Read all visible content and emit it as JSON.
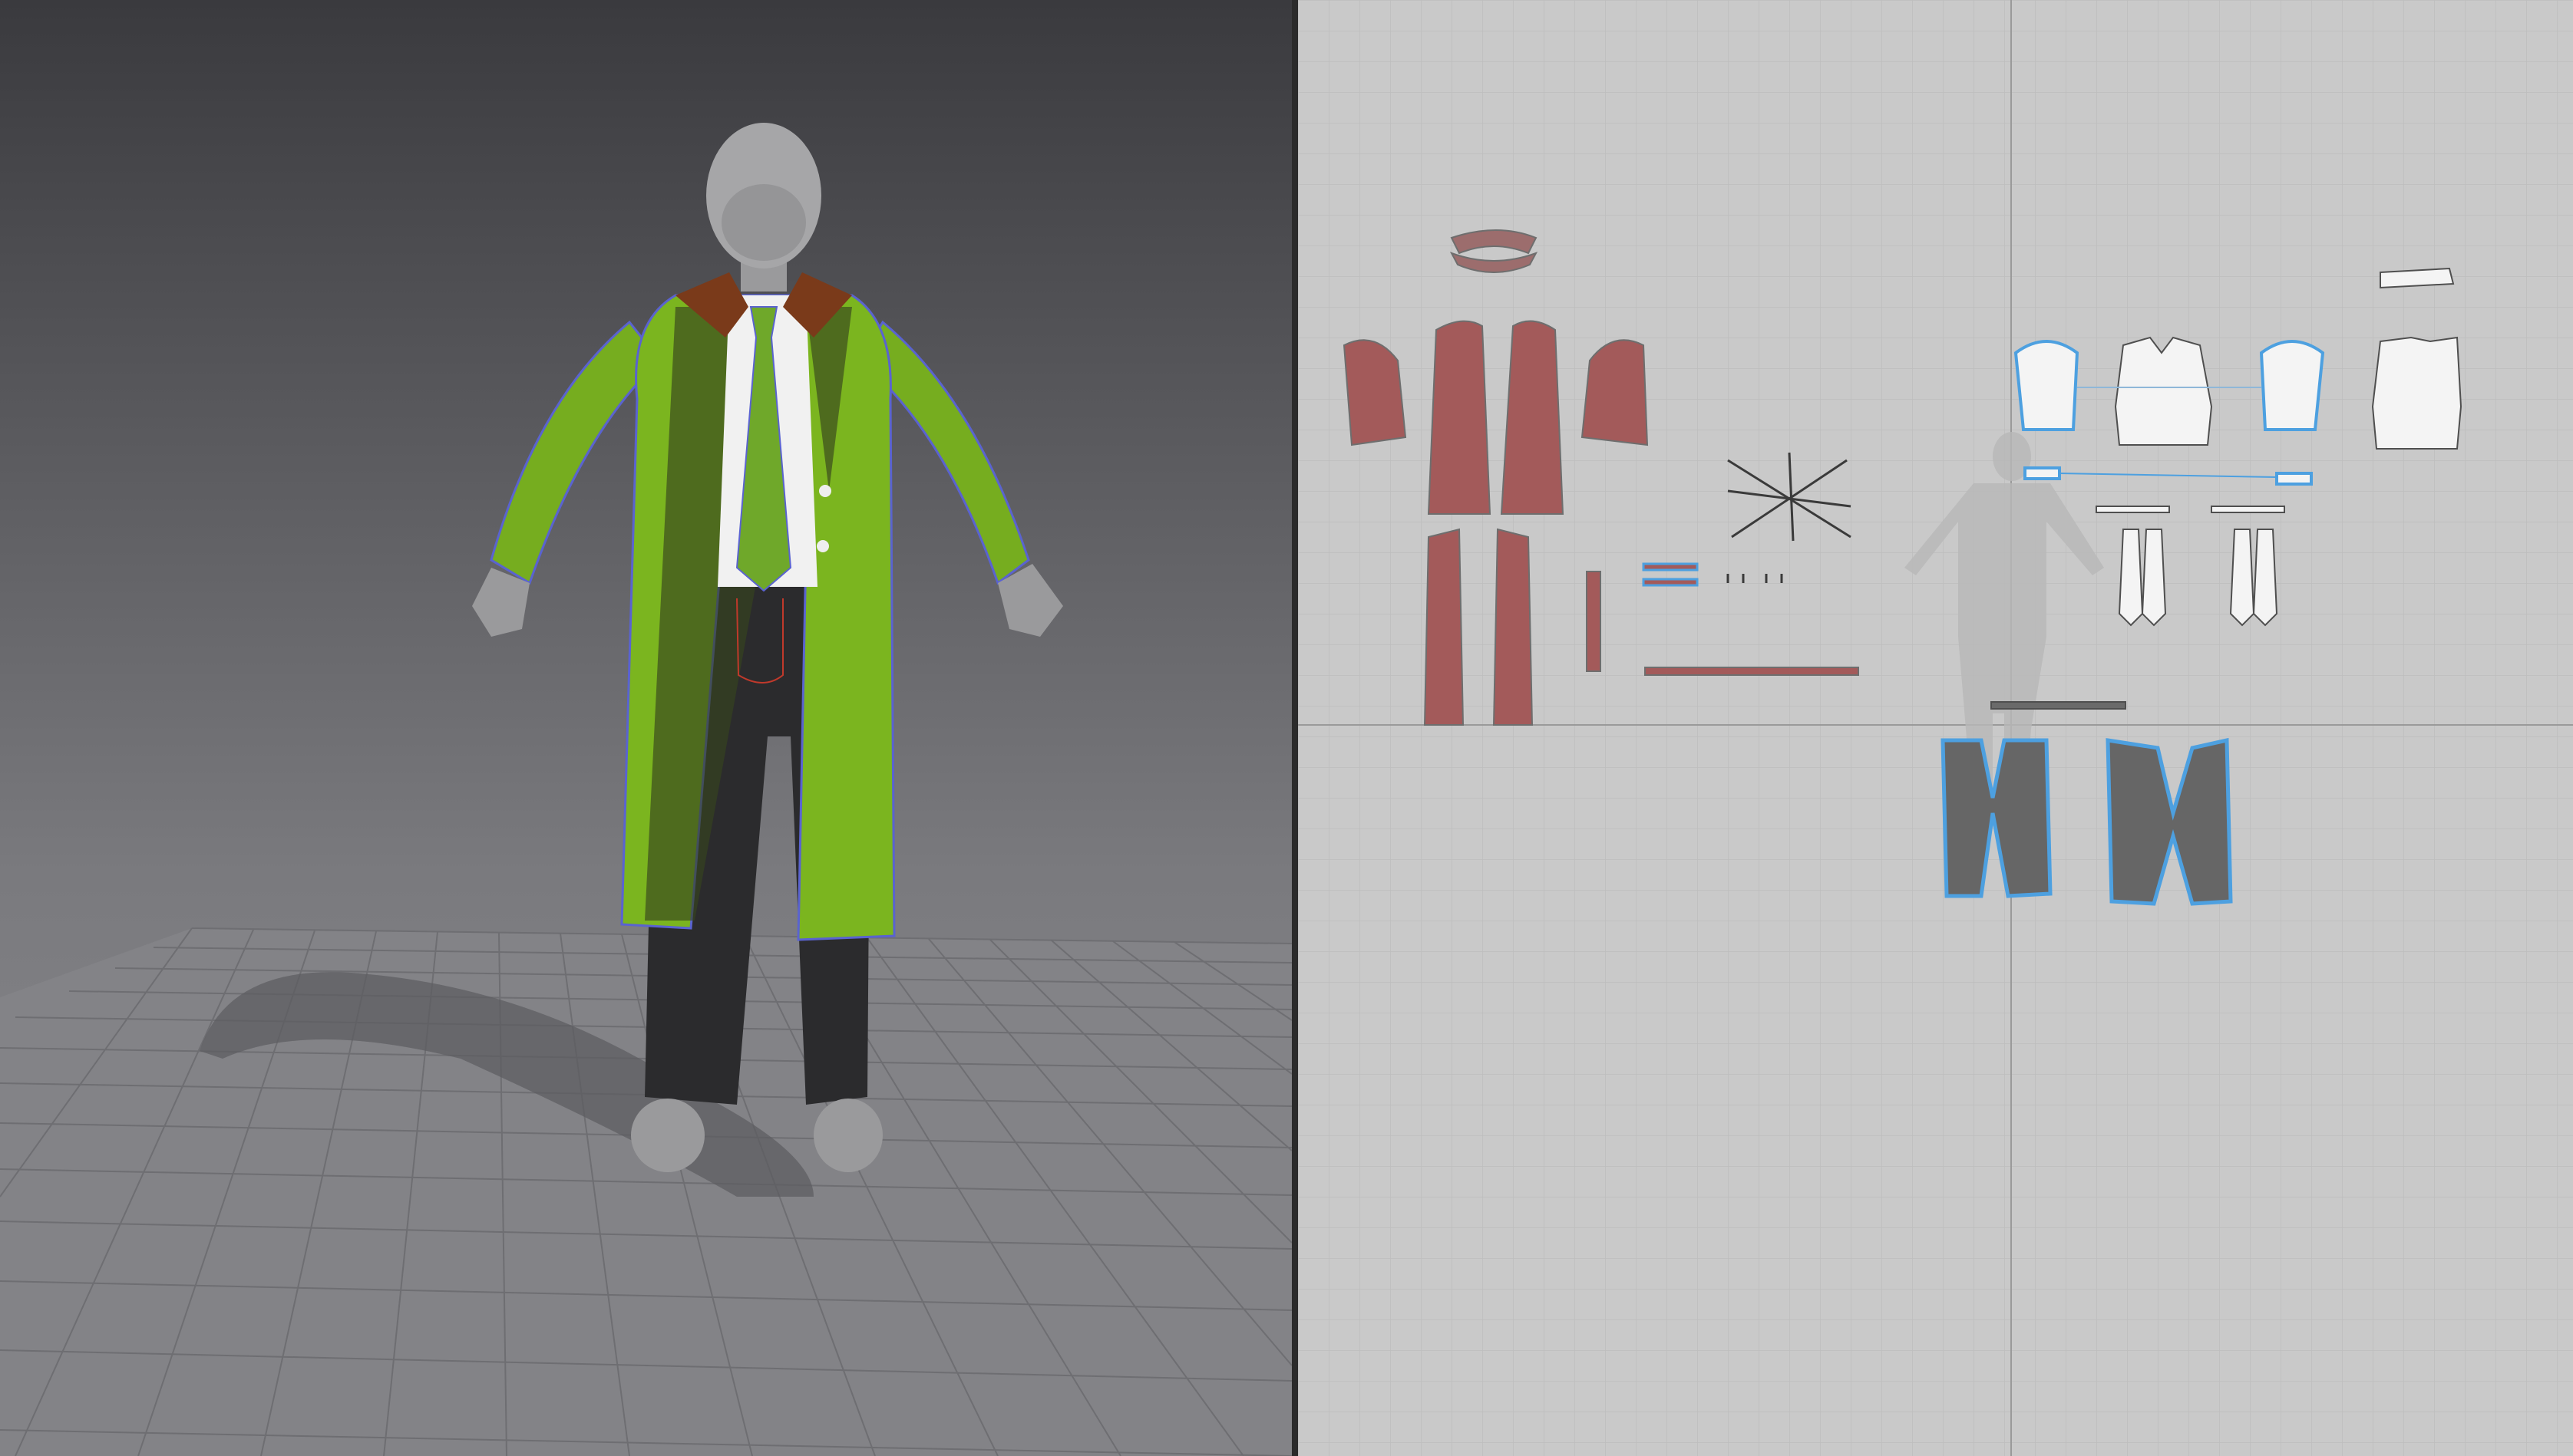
{
  "viewport_3d": {
    "label": "",
    "background_top": "#3a3a3e",
    "background_bottom": "#8c8c90"
  },
  "pattern_2d": {
    "label": "",
    "background": "#c9c9c9"
  },
  "colors": {
    "coat_fabric": "#7bb51f",
    "coat_outline": "#5a63d0",
    "lining": "#2f3a1f",
    "collar": "#7a3a1a",
    "shirt": "#f1f1f1",
    "tie": "#6fa82a",
    "pants": "#2b2b2b",
    "skin": "#9a9a9c",
    "coat_pattern_piece": "#a35a5a",
    "shirt_pattern_piece": "#f4f4f4",
    "pants_pattern_piece": "#666666",
    "selection_highlight": "#4da0e0"
  }
}
